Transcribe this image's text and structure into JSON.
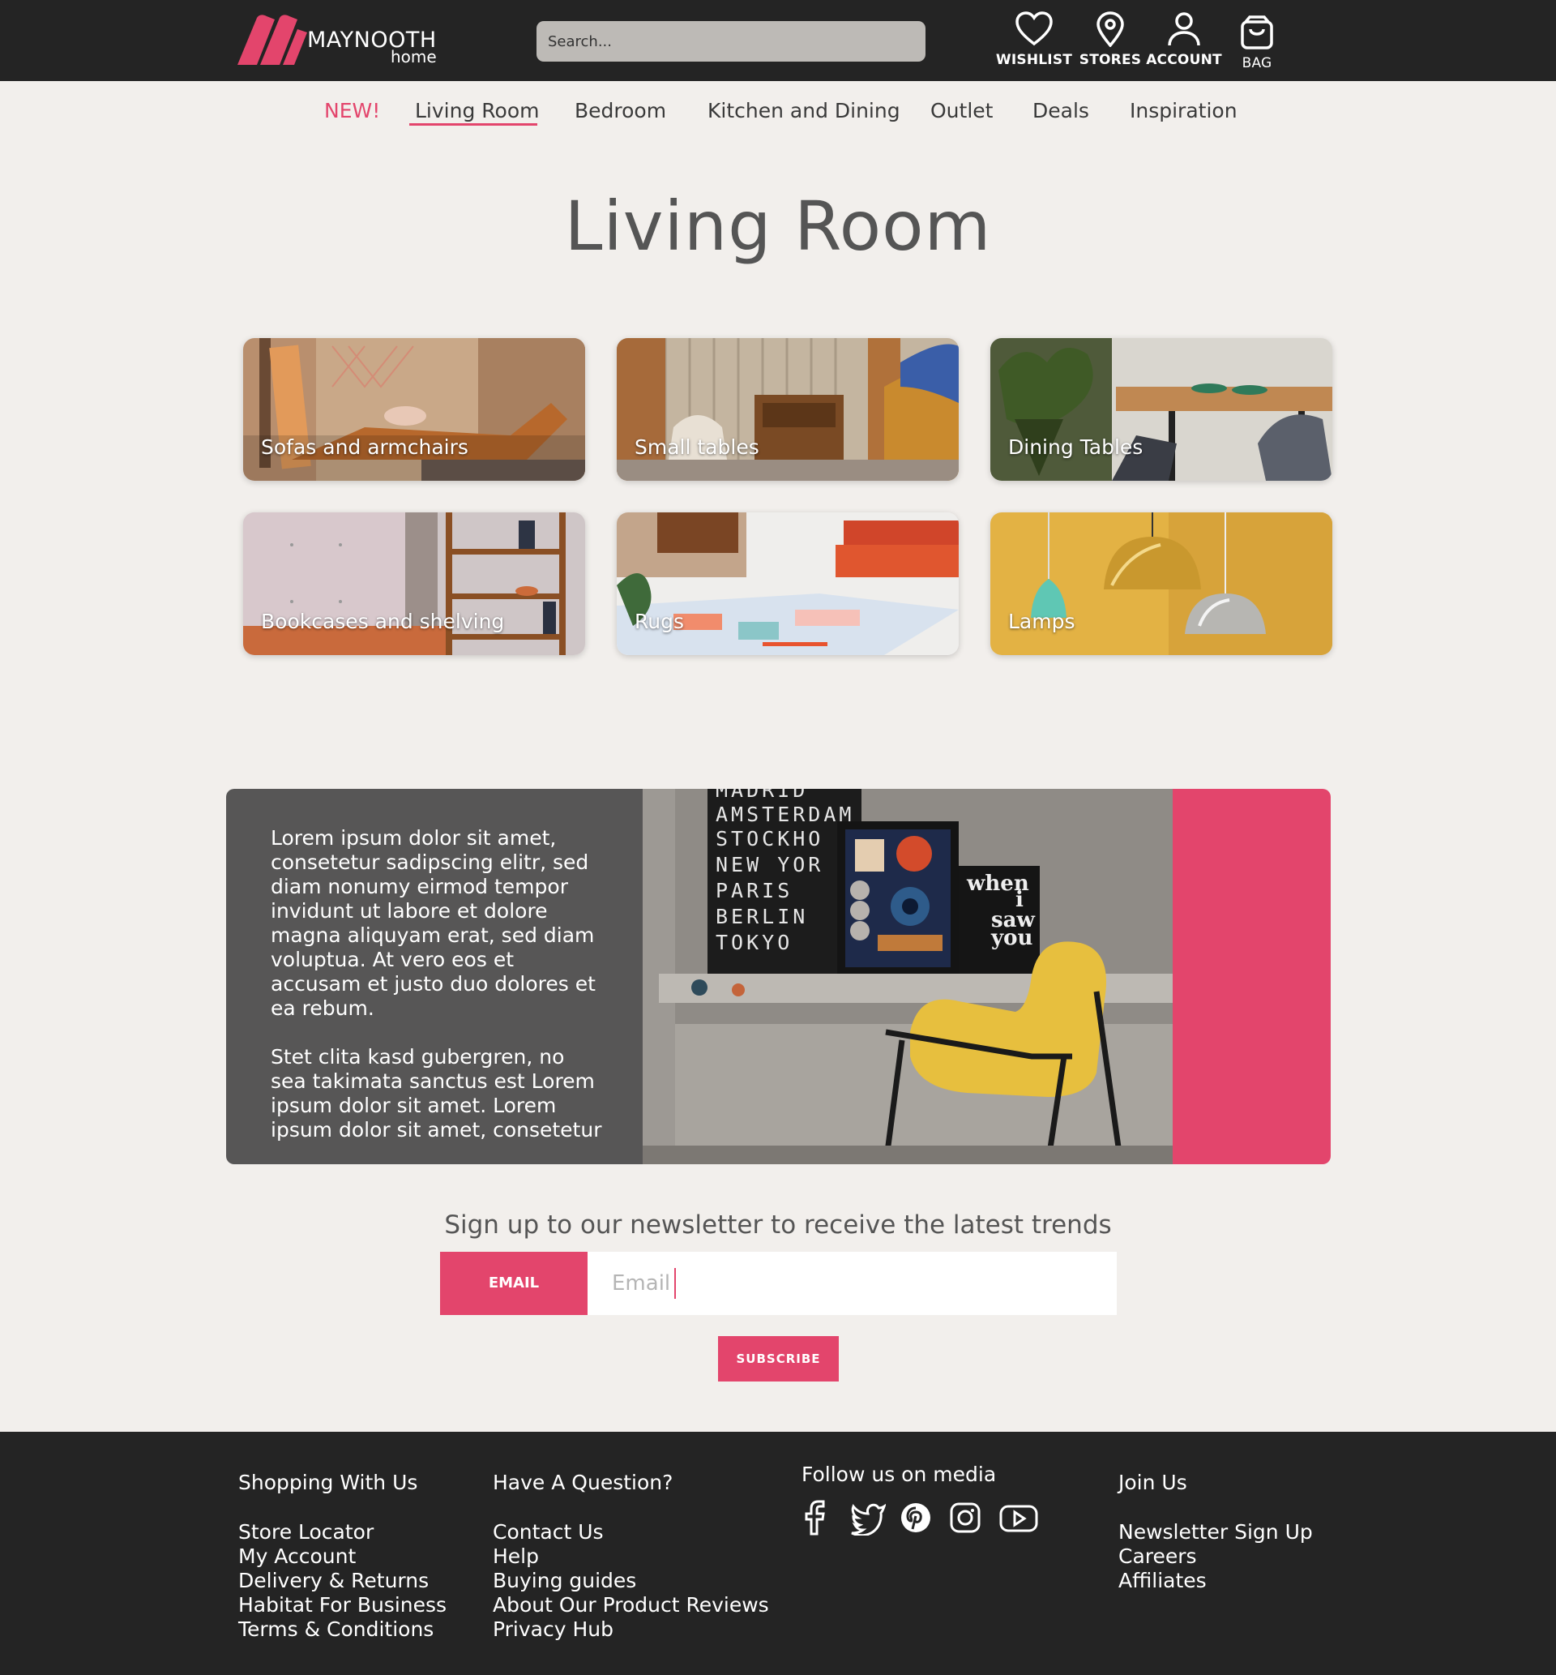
{
  "brand": {
    "name": "MAYNOOTH",
    "sub": "home"
  },
  "search": {
    "placeholder": "Search..."
  },
  "header_icons": [
    {
      "label": "WISHLIST",
      "icon": "heart-icon"
    },
    {
      "label": "STORES",
      "icon": "map-pin-icon"
    },
    {
      "label": "ACCOUNT",
      "icon": "user-icon"
    },
    {
      "label": "BAG",
      "icon": "shopping-bag-icon"
    }
  ],
  "nav": {
    "items": [
      "NEW!",
      "Living Room",
      "Bedroom",
      "Kitchen and Dining",
      "Outlet",
      "Deals",
      "Inspiration"
    ],
    "active": "Living Room"
  },
  "page_title": "Living Room",
  "categories": [
    "Sofas and armchairs",
    "Small tables",
    "Dining Tables",
    "Bookcases and shelving",
    "Rugs",
    "Lamps"
  ],
  "promo": {
    "paragraphs": [
      "Lorem ipsum dolor sit amet, consetetur sadipscing elitr, sed diam nonumy eirmod tempor invidunt ut labore et dolore magna aliquyam erat, sed diam voluptua. At vero eos et accusam et justo duo dolores et ea rebum.",
      "Stet clita kasd gubergren, no sea takimata sanctus est Lorem ipsum dolor sit amet. Lorem ipsum dolor sit amet, consetetur"
    ],
    "poster_cities": [
      "MADRID",
      "AMSTERDAM",
      "STOCKHO",
      "NEW YOR",
      "PARIS",
      "BERLIN",
      "TOKYO"
    ],
    "poster_words": [
      "when",
      "i",
      "saw",
      "you"
    ]
  },
  "newsletter": {
    "title": "Sign up to our newsletter to receive the latest trends",
    "label": "EMAIL",
    "placeholder": "Email",
    "button": "SUBSCRIBE"
  },
  "footer": {
    "shopping": {
      "title": "Shopping With Us",
      "links": [
        "Store Locator",
        "My Account",
        "Delivery & Returns",
        "Habitat For Business",
        "Terms & Conditions"
      ]
    },
    "question": {
      "title": "Have A Question?",
      "links": [
        "Contact Us",
        "Help",
        "Buying guides",
        "About Our Product Reviews",
        "Privacy Hub"
      ]
    },
    "follow": {
      "title": "Follow us on media",
      "icons": [
        "facebook-icon",
        "twitter-icon",
        "pinterest-icon",
        "instagram-icon",
        "youtube-icon"
      ]
    },
    "join": {
      "title": "Join Us",
      "links": [
        "Newsletter Sign Up",
        "Careers",
        "Affiliates"
      ]
    }
  },
  "colors": {
    "accent": "#e3456c",
    "dark": "#242424",
    "panel": "#575656",
    "background": "#f2efec"
  }
}
